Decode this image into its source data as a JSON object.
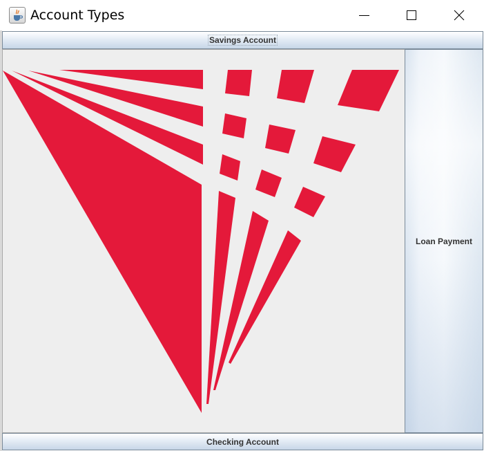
{
  "window": {
    "title": "Account Types",
    "icon": "java-cup-icon"
  },
  "titlebar_buttons": {
    "minimize": "minimize-icon",
    "maximize": "maximize-icon",
    "close": "close-icon"
  },
  "buttons": {
    "north": "Savings Account",
    "east": "Loan Payment",
    "south": "Checking Account"
  },
  "center": {
    "image": "red-geometric-logo",
    "logo_color": "#e4193a",
    "background": "#eeeeee"
  }
}
